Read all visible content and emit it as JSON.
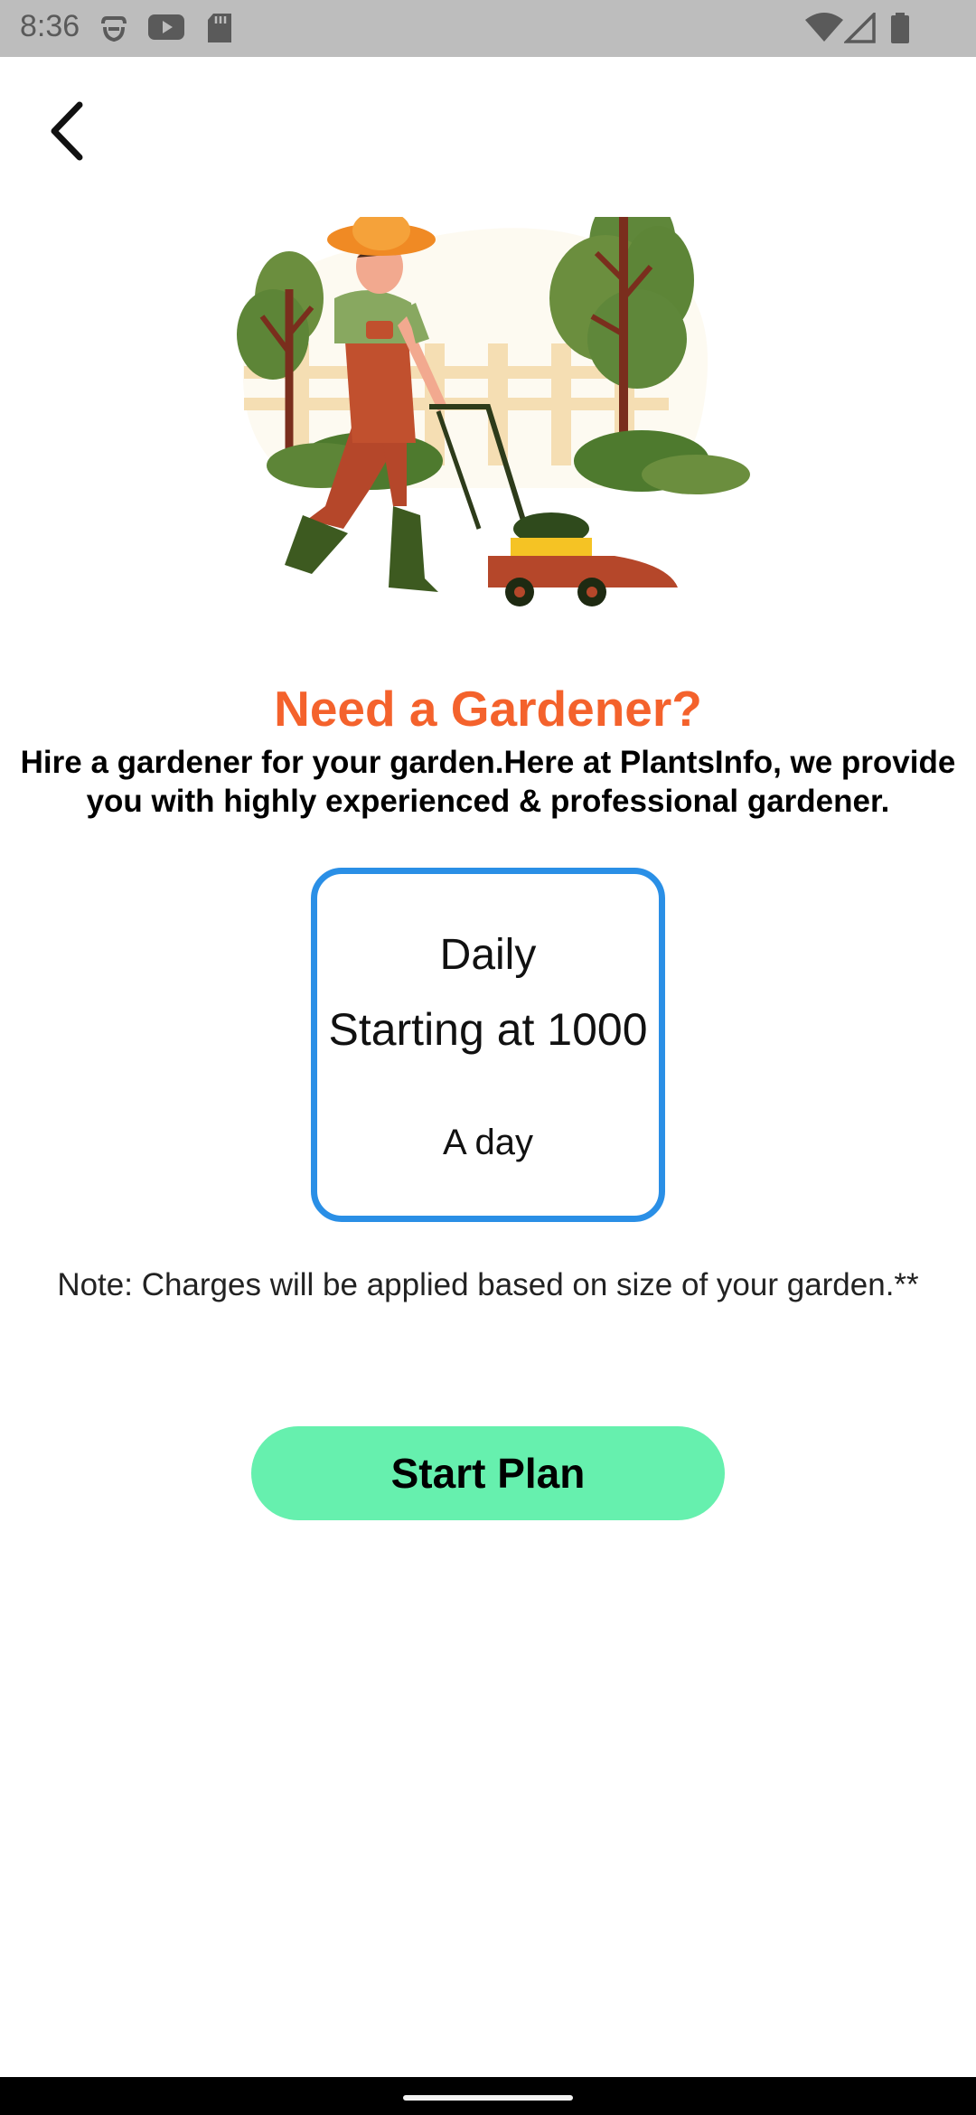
{
  "status_bar": {
    "time": "8:36",
    "left_icons": [
      "auth-icon",
      "youtube-icon",
      "sd-card-icon"
    ],
    "right_icons": [
      "wifi-icon",
      "signal-icon",
      "battery-icon"
    ]
  },
  "header": {
    "back_icon": "chevron-left-icon"
  },
  "hero": {
    "image": "gardener-mowing-illustration"
  },
  "title": "Need a Gardener?",
  "description": "Hire a gardener for your garden.Here at PlantsInfo, we provide you with highly experienced & professional gardener.",
  "plan": {
    "name": "Daily",
    "price": "Starting at 1000",
    "unit": "A day"
  },
  "note": "Note: Charges will be applied based on size of your garden.**",
  "cta": {
    "label": "Start Plan"
  },
  "colors": {
    "title": "#f4622c",
    "card_border": "#2a8fe6",
    "button": "#66f0ae",
    "status_bar": "#bdbdbd"
  }
}
